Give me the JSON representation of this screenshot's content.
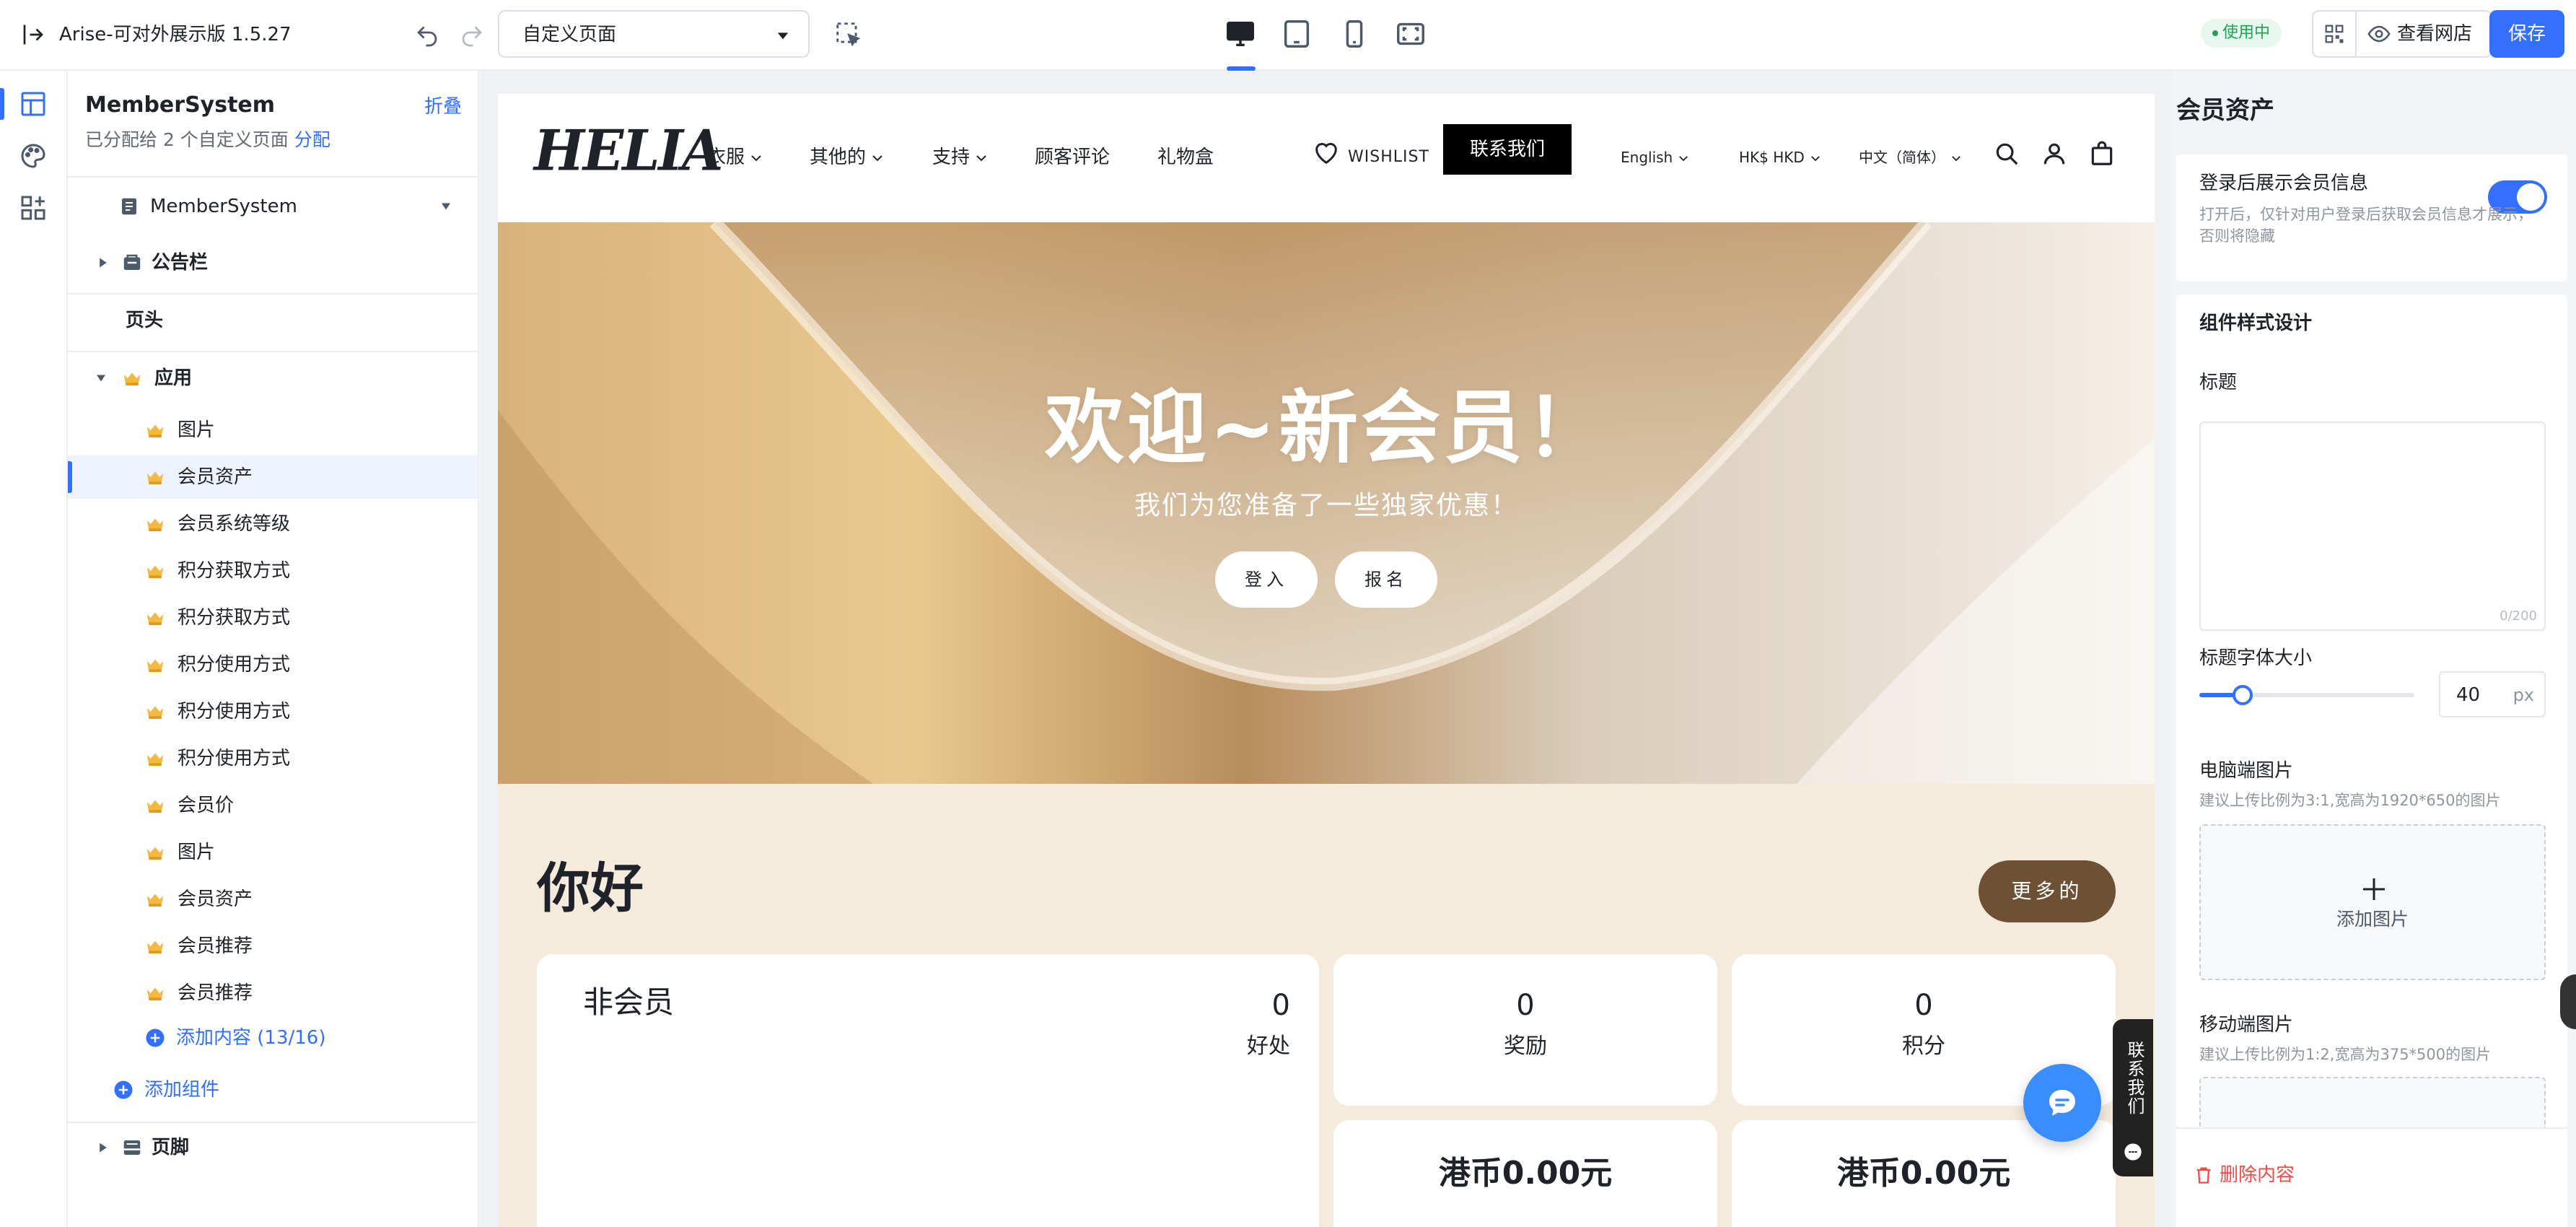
{
  "topbar": {
    "app_name": "Arise-可对外展示版 1.5.27",
    "page_select": "自定义页面",
    "status": "使用中",
    "view_store": "查看网店",
    "save": "保存"
  },
  "tree": {
    "title": "MemberSystem",
    "collapse": "折叠",
    "assigned": "已分配给 2 个自定义页面",
    "assign_link": "分配",
    "template": "MemberSystem",
    "announcement": "公告栏",
    "header": "页头",
    "apps_group": "应用",
    "items": [
      {
        "label": "图片"
      },
      {
        "label": "会员资产"
      },
      {
        "label": "会员系统等级"
      },
      {
        "label": "积分获取方式"
      },
      {
        "label": "积分获取方式"
      },
      {
        "label": "积分使用方式"
      },
      {
        "label": "积分使用方式"
      },
      {
        "label": "积分使用方式"
      },
      {
        "label": "会员价"
      },
      {
        "label": "图片"
      },
      {
        "label": "会员资产"
      },
      {
        "label": "会员推荐"
      },
      {
        "label": "会员推荐"
      }
    ],
    "selected_index": 1,
    "add_content": "添加内容 (13/16)",
    "add_component": "添加组件",
    "footer": "页脚"
  },
  "store": {
    "logo": "HELIA",
    "nav": [
      "衣服",
      "其他的",
      "支持",
      "顾客评论",
      "礼物盒"
    ],
    "wishlist": "WISHLIST",
    "contact": "联系我们",
    "language": "English",
    "currency": "HK$ HKD",
    "locale": "中文（简体）",
    "hero": {
      "title": "欢迎~新会员！",
      "subtitle": "我们为您准备了一些独家优惠！",
      "login": "登入",
      "signup": "报名"
    },
    "member": {
      "greeting": "你好",
      "more": "更多的",
      "level": "非会员",
      "benefits_value": "0",
      "benefits_label": "好处",
      "rewards_value": "0",
      "rewards_label": "奖励",
      "points_value": "0",
      "points_label": "积分",
      "balance_1": "港币0.00元",
      "balance_2": "港币0.00元"
    },
    "side_tab": "联系我们"
  },
  "panel": {
    "title": "会员资产",
    "show_after_login": "登录后展示会员信息",
    "show_hint": "打开后，仅针对用户登录后获取会员信息才展示，否则将隐藏",
    "show_enabled": true,
    "style_section": "组件样式设计",
    "title_label": "标题",
    "title_counter": "0/200",
    "font_size_label": "标题字体大小",
    "font_size_value": "40",
    "font_size_unit": "px",
    "font_size_level": 0.2,
    "pc_image_label": "电脑端图片",
    "pc_image_hint": "建议上传比例为3:1,宽高为1920*650的图片",
    "add_image": "添加图片",
    "mobile_image_label": "移动端图片",
    "mobile_image_hint": "建议上传比例为1:2,宽高为375*500的图片",
    "delete": "删除内容"
  }
}
